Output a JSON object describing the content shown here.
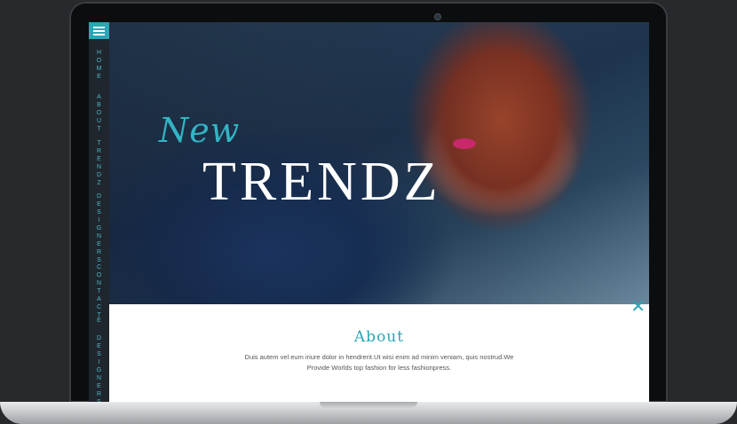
{
  "nav": {
    "menu_icon": "hamburger-menu-icon",
    "items": [
      "HOME",
      "ABOUT",
      "TRENDZ",
      "DESIGNERS",
      "CONTACT",
      "E",
      "DESIGNERS"
    ]
  },
  "hero": {
    "new": "New",
    "trendz": "TRENDZ"
  },
  "about": {
    "close_icon": "close-icon",
    "title": "About",
    "text": "Duis autem vel eum iriure dolor in hendrerit.Ut wisi enim ad minim veniam, quis nostrud.We Provide Worlds top fashion for less fashionpress."
  },
  "colors": {
    "accent": "#2aa6b4",
    "sidebar": "#20262e",
    "background": "#262a2d"
  }
}
